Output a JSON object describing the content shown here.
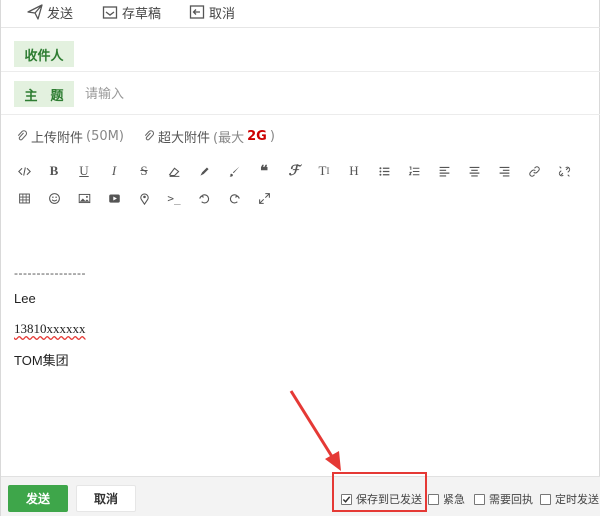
{
  "toolbar": {
    "send_label": "发送",
    "draft_label": "存草稿",
    "cancel_label": "取消"
  },
  "header": {
    "recipient_label": "收件人",
    "subject_label": "主　题",
    "subject_placeholder": "请输入"
  },
  "attachments": {
    "upload_label": "上传附件",
    "upload_limit": "(50M)",
    "large_label": "超大附件",
    "large_prefix": "(最大",
    "large_size": "2G",
    "large_suffix": ")"
  },
  "editor_toolbar": {
    "row1": [
      "code-view-icon",
      "bold-icon",
      "underline-icon",
      "italic-icon",
      "strikethrough-icon",
      "eraser-icon",
      "highlighter-icon",
      "brush-icon",
      "quote-icon",
      "font-icon",
      "font-size-icon",
      "heading-icon",
      "bulleted-list-icon",
      "numbered-list-icon",
      "align-left-icon",
      "align-center-icon",
      "align-right-icon",
      "link-icon",
      "unlink-icon"
    ],
    "row2": [
      "table-icon",
      "emoji-icon",
      "image-icon",
      "video-icon",
      "location-icon",
      "terminal-icon",
      "undo-icon",
      "redo-icon",
      "fullscreen-icon"
    ]
  },
  "body": {
    "divider": "----------------",
    "sig_name": "Lee",
    "sig_phone": "13810xxxxxx",
    "sig_company": "TOM集团"
  },
  "footer": {
    "send_label": "发送",
    "cancel_label": "取消",
    "options": [
      {
        "label": "保存到已发送",
        "checked": true
      },
      {
        "label": "紧急",
        "checked": false
      },
      {
        "label": "需要回执",
        "checked": false
      },
      {
        "label": "定时发送",
        "checked": false
      }
    ]
  },
  "colors": {
    "accent": "#3ea64a",
    "label_bg": "#e3f1df",
    "label_text": "#2e7d32",
    "highlight": "#e53935"
  }
}
